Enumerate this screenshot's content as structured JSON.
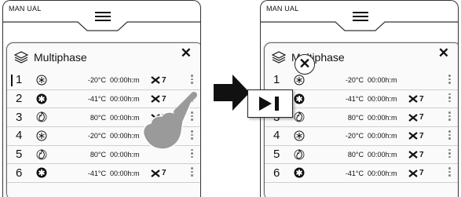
{
  "left_screen": {
    "mode_label": "MAN UAL",
    "panel_title": "Multiphase",
    "rows": [
      {
        "num": "1",
        "icon": "snowflake-icon",
        "temp": "-20°C",
        "time": "00:00h:m",
        "fan": "7"
      },
      {
        "num": "2",
        "icon": "snowflake-bold-icon",
        "temp": "-41°C",
        "time": "00:00h:m",
        "fan": "7"
      },
      {
        "num": "3",
        "icon": "heat-icon",
        "temp": "80°C",
        "time": "00:00h:m",
        "fan": "7"
      },
      {
        "num": "4",
        "icon": "snowflake-icon",
        "temp": "-20°C",
        "time": "00:00h:m",
        "fan": ""
      },
      {
        "num": "5",
        "icon": "heat-icon",
        "temp": "80°C",
        "time": "00:00h:m",
        "fan": ""
      },
      {
        "num": "6",
        "icon": "snowflake-bold-icon",
        "temp": "-41°C",
        "time": "00:00h:m",
        "fan": "7"
      }
    ]
  },
  "right_screen": {
    "mode_label": "MAN UAL",
    "panel_title": "Multiphase",
    "rows": [
      {
        "num": "1",
        "icon": "snowflake-icon",
        "temp": "-20°C",
        "time": "00:00h:m",
        "fan": ""
      },
      {
        "num": "2",
        "icon": "snowflake-bold-icon",
        "temp": "-41°C",
        "time": "00:00h:m",
        "fan": "7"
      },
      {
        "num": "3",
        "icon": "heat-icon",
        "temp": "80°C",
        "time": "00:00h:m",
        "fan": "7"
      },
      {
        "num": "4",
        "icon": "snowflake-icon",
        "temp": "-20°C",
        "time": "00:00h:m",
        "fan": "7"
      },
      {
        "num": "5",
        "icon": "heat-icon",
        "temp": "80°C",
        "time": "00:00h:m",
        "fan": "7"
      },
      {
        "num": "6",
        "icon": "snowflake-bold-icon",
        "temp": "-41°C",
        "time": "00:00h:m",
        "fan": "7"
      }
    ]
  },
  "close_symbol": "✕",
  "colors": {
    "hand": "#9a9a9a",
    "arrow": "#111111",
    "row_divider": "#cfcfcf"
  }
}
